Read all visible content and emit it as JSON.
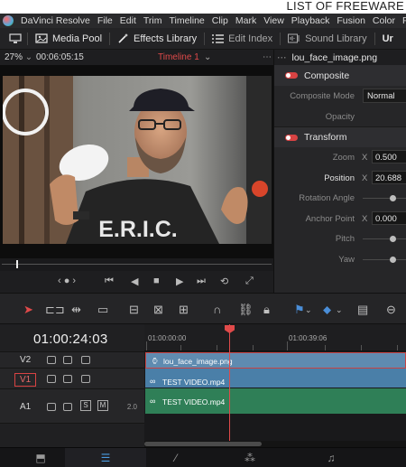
{
  "watermark": "LIST OF FREEWARE",
  "menu": [
    "DaVinci Resolve",
    "File",
    "Edit",
    "Trim",
    "Timeline",
    "Clip",
    "Mark",
    "View",
    "Playback",
    "Fusion",
    "Color",
    "Fairlight"
  ],
  "toolbar": {
    "media_pool": "Media Pool",
    "effects_library": "Effects Library",
    "edit_index": "Edit Index",
    "sound_library": "Sound Library",
    "overflow": "Ur"
  },
  "viewer": {
    "zoom": "27%",
    "timecode": "00:06:05:15",
    "timeline_name": "Timeline 1",
    "shirt_text": "E.R.I.C."
  },
  "inspector": {
    "clip_name": "lou_face_image.png",
    "composite": {
      "title": "Composite",
      "mode_label": "Composite Mode",
      "mode_value": "Normal",
      "opacity_label": "Opacity"
    },
    "transform": {
      "title": "Transform",
      "zoom_label": "Zoom",
      "zoom_x": "0.500",
      "position_label": "Position",
      "position_x": "20.688",
      "rotation_label": "Rotation Angle",
      "anchor_label": "Anchor Point",
      "anchor_x": "0.000",
      "pitch_label": "Pitch",
      "yaw_label": "Yaw",
      "axis": "X"
    }
  },
  "timeline": {
    "timecode": "01:00:24:03",
    "ruler_start": "01:00:00:00",
    "ruler_mid": "01:00:39:06",
    "tracks": [
      {
        "id": "V2",
        "clip": "lou_face_image.png"
      },
      {
        "id": "V1",
        "clip": "TEST VIDEO.mp4"
      },
      {
        "id": "A1",
        "clip": "TEST VIDEO.mp4",
        "level": "2.0",
        "solo": "S",
        "mute": "M"
      }
    ]
  },
  "colors": {
    "accent_red": "#d84343",
    "video_clip": "#4a7fa8",
    "audio_clip": "#2f7f57",
    "active_page": "#4a9be0"
  },
  "pages": [
    "media-icon",
    "cut-icon",
    "edit-icon",
    "fusion-icon",
    "color-icon",
    "fairlight-icon"
  ]
}
